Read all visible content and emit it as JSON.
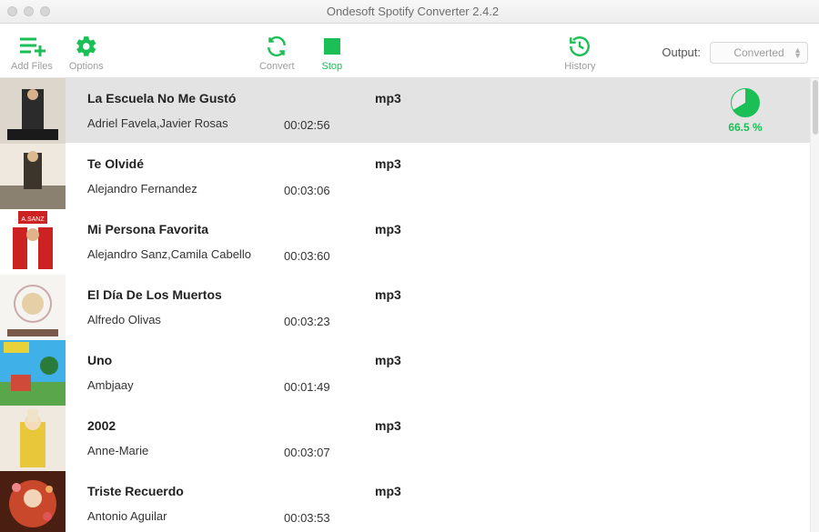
{
  "window": {
    "title": "Ondesoft Spotify Converter 2.4.2"
  },
  "toolbar": {
    "add_files": "Add Files",
    "options": "Options",
    "convert": "Convert",
    "stop": "Stop",
    "history": "History",
    "output_label": "Output:",
    "output_value": "Converted"
  },
  "colors": {
    "accent": "#1bbf56"
  },
  "progress": {
    "percent": 66.5,
    "label": "66.5 %"
  },
  "tracks": [
    {
      "title": "La Escuela No Me Gustó",
      "artist": "Adriel Favela,Javier Rosas",
      "duration": "00:02:56",
      "format": "mp3",
      "active": true,
      "progress": 66.5
    },
    {
      "title": "Te Olvidé",
      "artist": "Alejandro Fernandez",
      "duration": "00:03:06",
      "format": "mp3"
    },
    {
      "title": "Mi Persona Favorita",
      "artist": "Alejandro Sanz,Camila Cabello",
      "duration": "00:03:60",
      "format": "mp3"
    },
    {
      "title": "El Día De Los Muertos",
      "artist": "Alfredo Olivas",
      "duration": "00:03:23",
      "format": "mp3"
    },
    {
      "title": "Uno",
      "artist": "Ambjaay",
      "duration": "00:01:49",
      "format": "mp3"
    },
    {
      "title": "2002",
      "artist": "Anne-Marie",
      "duration": "00:03:07",
      "format": "mp3"
    },
    {
      "title": "Triste Recuerdo",
      "artist": "Antonio Aguilar",
      "duration": "00:03:53",
      "format": "mp3"
    }
  ]
}
